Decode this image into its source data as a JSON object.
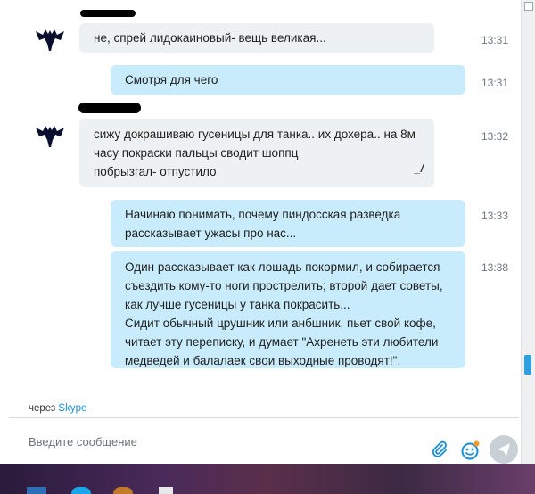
{
  "messages": [
    {
      "side": "in",
      "lines": [
        "не, спрей лидокаиновый- вещь великая..."
      ],
      "time": "13:31"
    },
    {
      "side": "out",
      "lines": [
        "Смотря для чего"
      ],
      "time": "13:31"
    },
    {
      "side": "in",
      "lines": [
        "сижу докрашиваю гусеницы для танка.. их дохера.. на 8м",
        "часу покраски пальцы сводит шоппц",
        "побрызгал- отпустило"
      ],
      "time": "13:32",
      "edited_mark": "_/"
    },
    {
      "side": "out",
      "lines": [
        "Начинаю понимать, почему пиндосская разведка",
        "рассказывает ужасы про нас..."
      ],
      "time": "13:33"
    },
    {
      "side": "out",
      "lines": [
        "Один рассказывает как лошадь покормил, и собирается",
        "съездить кому-то ноги прострелить; второй дает советы,",
        "как лучше гусеницы у танка покрасить...",
        "Сидит обычный црушник или анбшник, пьет свой кофе,",
        "читает эту переписку, и думает \"Ахренеть эти любители",
        "медведей и балалаек свои выходные проводят!\"."
      ],
      "time": "13:38"
    }
  ],
  "footer": {
    "via_prefix": "через",
    "via_app": "Skype"
  },
  "composer": {
    "placeholder": "Введите сообщение",
    "attach_icon": "paperclip-icon",
    "emoji_icon": "emoji-icon",
    "send_icon": "send-icon"
  },
  "colors": {
    "incoming_bubble": "#eef1f3",
    "outgoing_bubble": "#c9ecfc",
    "accent": "#1a8fd6",
    "send_button": "#c8d0d6"
  }
}
